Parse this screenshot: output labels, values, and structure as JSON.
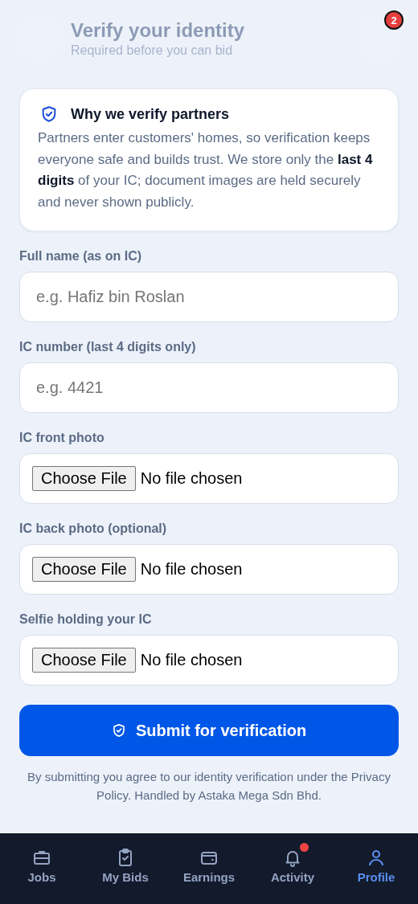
{
  "header": {
    "title": "Verify your identity",
    "subtitle": "Required before you can bid",
    "badge": "2"
  },
  "info_card": {
    "title": "Why we verify partners",
    "body": "Partners enter customers' homes, so verification keeps everyone safe and builds trust. We store only the **last 4 digits** of your IC; document images are held securely and never shown publicly."
  },
  "fields": [
    {
      "kind": "text",
      "label": "Full name (as on IC)",
      "placeholder": "e.g. Hafiz bin Roslan"
    },
    {
      "kind": "text",
      "label": "IC number (last 4 digits only)",
      "placeholder": "e.g. 4421"
    },
    {
      "kind": "file",
      "label": "IC front photo",
      "button": "Choose File",
      "status": "No file chosen"
    },
    {
      "kind": "file",
      "label": "IC back photo (optional)",
      "button": "Choose File",
      "status": "No file chosen"
    },
    {
      "kind": "file",
      "label": "Selfie holding your IC",
      "button": "Choose File",
      "status": "No file chosen"
    }
  ],
  "submit": {
    "label": "Submit for verification"
  },
  "footnote": "By submitting you agree to our identity verification under the Privacy Policy. Handled by Astaka Mega Sdn Bhd.",
  "nav": [
    {
      "kind": "jobs",
      "label": "Jobs",
      "selected": false,
      "dot": false
    },
    {
      "kind": "bids",
      "label": "My Bids",
      "selected": false,
      "dot": false
    },
    {
      "kind": "earnings",
      "label": "Earnings",
      "selected": false,
      "dot": false
    },
    {
      "kind": "activity",
      "label": "Activity",
      "selected": false,
      "dot": true
    },
    {
      "kind": "profile",
      "label": "Profile",
      "selected": true,
      "dot": false
    }
  ]
}
